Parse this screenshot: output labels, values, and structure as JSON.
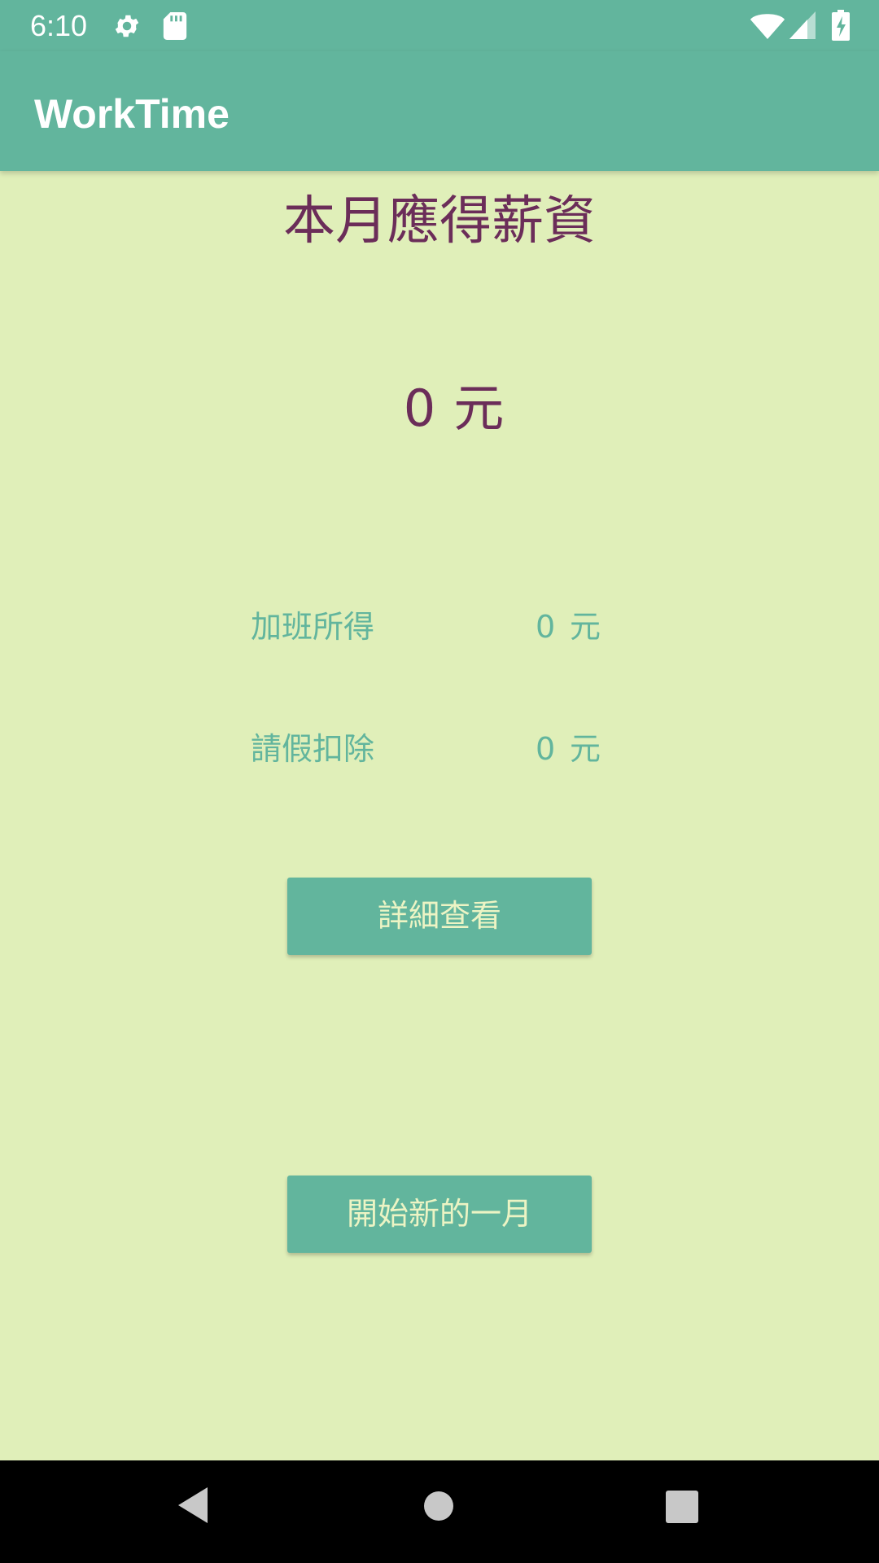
{
  "status_bar": {
    "time": "6:10",
    "icons": [
      "gear-icon",
      "sd-card-icon",
      "wifi-icon",
      "cell-signal-icon",
      "battery-charging-icon"
    ]
  },
  "app_bar": {
    "title": "WorkTime"
  },
  "main": {
    "heading": "本月應得薪資",
    "total_value": "0",
    "total_unit": "元",
    "rows": [
      {
        "label": "加班所得",
        "value": "0",
        "unit": "元"
      },
      {
        "label": "請假扣除",
        "value": "0",
        "unit": "元"
      }
    ],
    "details_button": "詳細查看",
    "new_month_button": "開始新的一月"
  },
  "nav_bar": {
    "icons": [
      "back-icon",
      "home-icon",
      "recents-icon"
    ]
  },
  "colors": {
    "primary": "#62b59d",
    "background": "#e0efb9",
    "heading_text": "#6b2d59",
    "button_text": "#ecf4c4"
  }
}
